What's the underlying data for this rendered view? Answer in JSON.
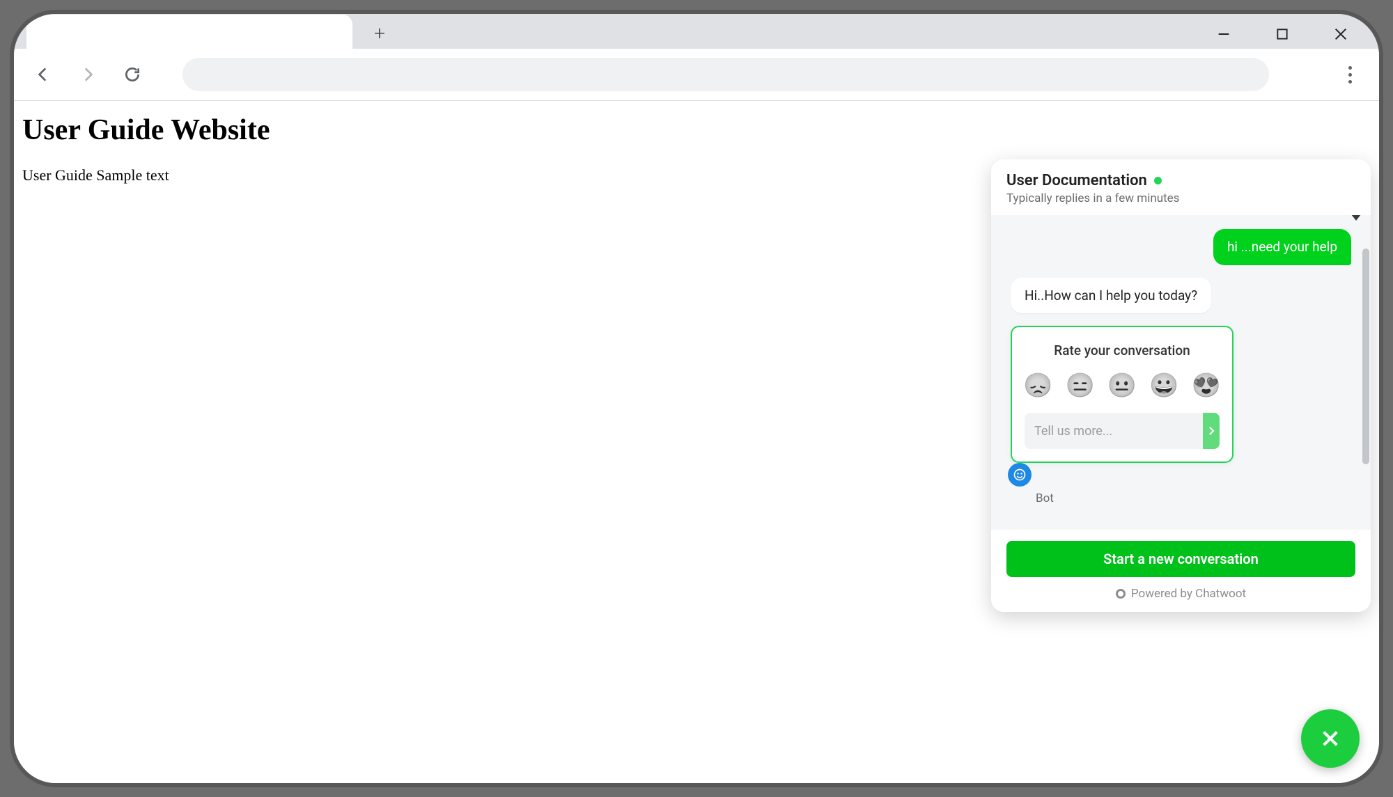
{
  "page": {
    "heading": "User Guide Website",
    "body": "User Guide Sample text"
  },
  "chat": {
    "title": "User Documentation",
    "subtitle": "Typically replies in a few minutes",
    "messages": {
      "me1": "hi ...need your help",
      "bot1": "Hi..How can I help you today?"
    },
    "rate": {
      "title": "Rate your conversation",
      "emojis": {
        "e1": "😞",
        "e2": "😑",
        "e3": "😐",
        "e4": "😀",
        "e5": "😍"
      },
      "placeholder": "Tell us more..."
    },
    "bot_label": "Bot",
    "start_button": "Start a new conversation",
    "powered": "Powered by Chatwoot"
  }
}
